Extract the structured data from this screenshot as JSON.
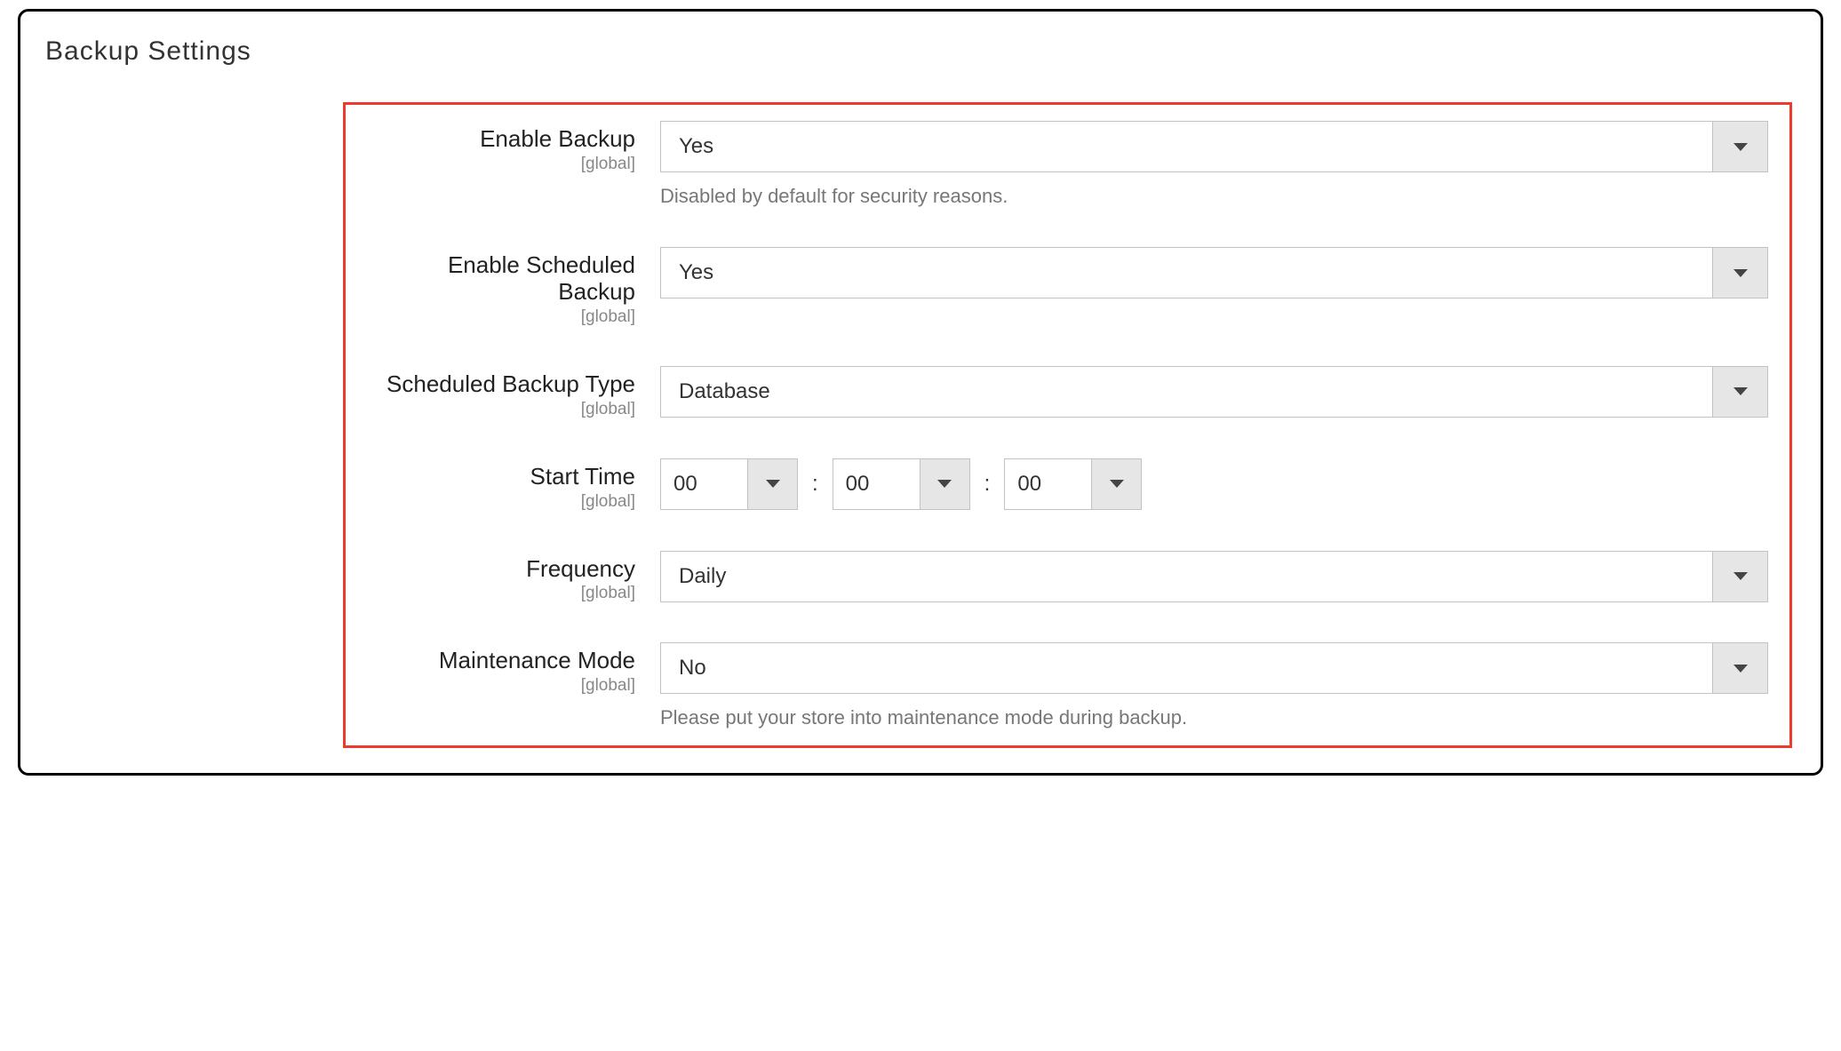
{
  "section": {
    "title": "Backup Settings"
  },
  "scope_label": "[global]",
  "fields": {
    "enable_backup": {
      "label": "Enable Backup",
      "value": "Yes",
      "note": "Disabled by default for security reasons."
    },
    "enable_scheduled": {
      "label": "Enable Scheduled Backup",
      "value": "Yes"
    },
    "backup_type": {
      "label": "Scheduled Backup Type",
      "value": "Database"
    },
    "start_time": {
      "label": "Start Time",
      "hours": "00",
      "minutes": "00",
      "seconds": "00",
      "sep": ":"
    },
    "frequency": {
      "label": "Frequency",
      "value": "Daily"
    },
    "maintenance": {
      "label": "Maintenance Mode",
      "value": "No",
      "note": "Please put your store into maintenance mode during backup."
    }
  }
}
